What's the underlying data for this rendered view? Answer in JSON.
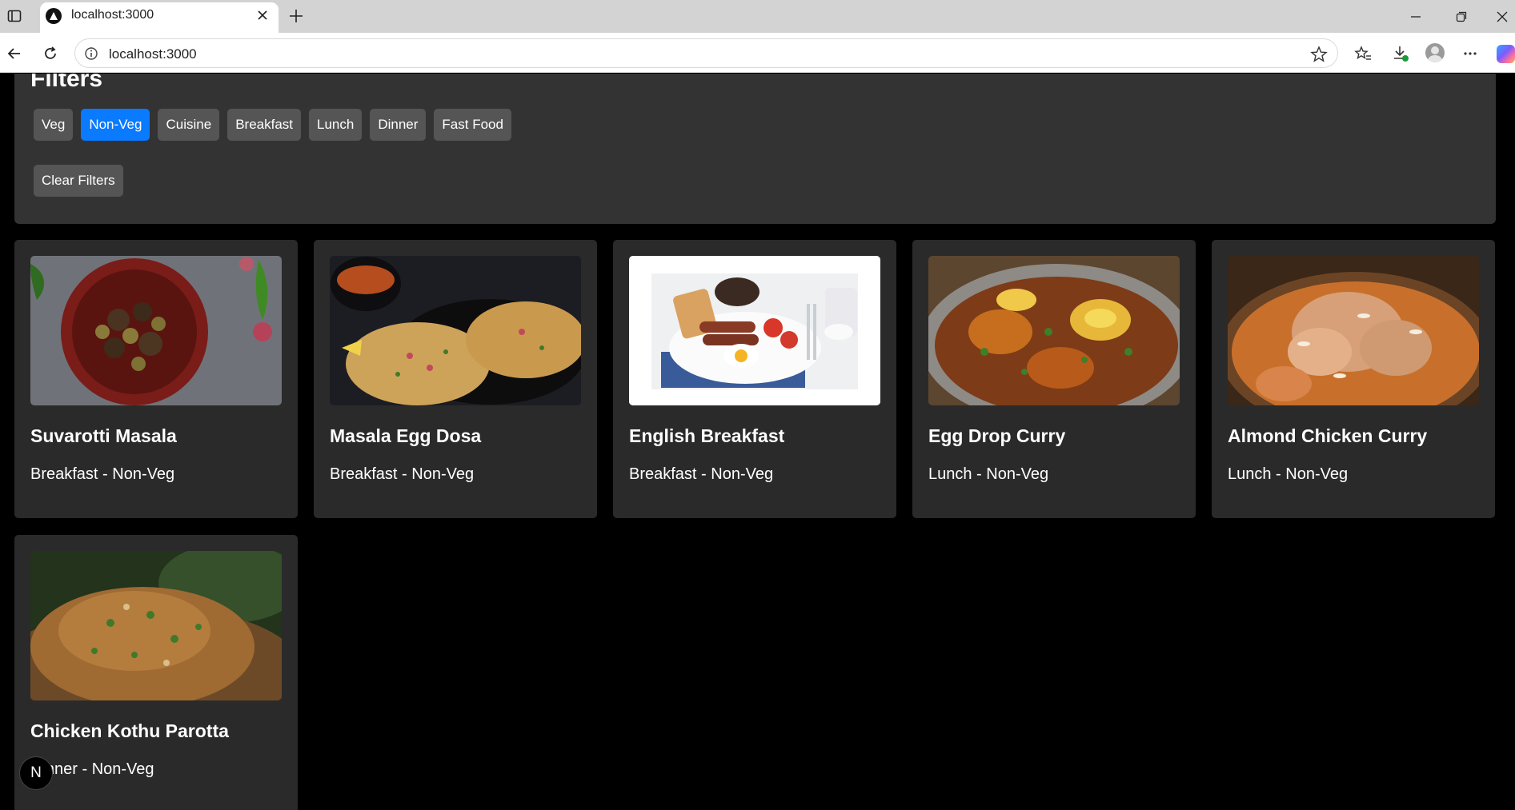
{
  "browser": {
    "tab_title": "localhost:3000",
    "url": "localhost:3000"
  },
  "filters": {
    "title": "Filters",
    "chips": [
      {
        "label": "Veg",
        "active": false
      },
      {
        "label": "Non-Veg",
        "active": true
      },
      {
        "label": "Cuisine",
        "active": false
      },
      {
        "label": "Breakfast",
        "active": false
      },
      {
        "label": "Lunch",
        "active": false
      },
      {
        "label": "Dinner",
        "active": false
      },
      {
        "label": "Fast Food",
        "active": false
      }
    ],
    "clear_label": "Clear Filters",
    "active_color": "#0a7aff"
  },
  "dishes": [
    {
      "name": "Suvarotti Masala",
      "meta": "Breakfast - Non-Veg"
    },
    {
      "name": "Masala Egg Dosa",
      "meta": "Breakfast - Non-Veg"
    },
    {
      "name": "English Breakfast",
      "meta": "Breakfast - Non-Veg"
    },
    {
      "name": "Egg Drop Curry",
      "meta": "Lunch - Non-Veg"
    },
    {
      "name": "Almond Chicken Curry",
      "meta": "Lunch - Non-Veg"
    },
    {
      "name": "Chicken Kothu Parotta",
      "meta": "Dinner - Non-Veg"
    }
  ],
  "dev_badge": {
    "letter": "N"
  }
}
